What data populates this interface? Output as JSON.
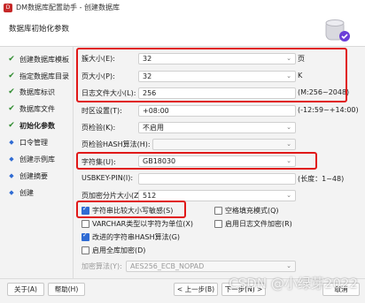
{
  "window": {
    "title": "DM数据库配置助手 - 创建数据库"
  },
  "header": {
    "title": "数据库初始化参数"
  },
  "sidebar": {
    "items": [
      {
        "label": "创建数据库模板",
        "state": "done"
      },
      {
        "label": "指定数据库目录",
        "state": "done"
      },
      {
        "label": "数据库标识",
        "state": "done"
      },
      {
        "label": "数据库文件",
        "state": "done"
      },
      {
        "label": "初始化参数",
        "state": "active"
      },
      {
        "label": "口令管理",
        "state": "pending"
      },
      {
        "label": "创建示例库",
        "state": "pending"
      },
      {
        "label": "创建摘要",
        "state": "pending"
      },
      {
        "label": "创建",
        "state": "pending"
      }
    ]
  },
  "form": {
    "extent_size": {
      "label": "簇大小(E):",
      "value": "32",
      "unit": "页"
    },
    "page_size": {
      "label": "页大小(P):",
      "value": "32",
      "unit": "K"
    },
    "log_size": {
      "label": "日志文件大小(L):",
      "value": "256",
      "unit": "(M:256~2048)"
    },
    "time_zone": {
      "label": "时区设置(T):",
      "value": "+08:00",
      "unit": "(-12:59~+14:00)"
    },
    "page_check": {
      "label": "页检验(K):",
      "value": "不启用"
    },
    "page_check_hash": {
      "label": "页检验HASH算法(H):",
      "value": ""
    },
    "charset": {
      "label": "字符集(U):",
      "value": "GB18030"
    },
    "usbkey_pin": {
      "label": "USBKEY-PIN(I):",
      "value": "",
      "unit": "(长度：1~48)"
    },
    "page_partition": {
      "label": "页加密分片大小(Z):",
      "value": "512"
    },
    "case_sensitive": {
      "label": "字符串比较大小写敏感(S)",
      "checked": true
    },
    "space_fill": {
      "label": "空格填充模式(Q)",
      "checked": false
    },
    "varchar_char": {
      "label": "VARCHAR类型以字符为单位(X)",
      "checked": false
    },
    "log_encrypt": {
      "label": "启用日志文件加密(R)",
      "checked": false
    },
    "improved_hash": {
      "label": "改进的字符串HASH算法(G)",
      "checked": true
    },
    "full_db_encrypt": {
      "label": "启用全库加密(D)",
      "checked": false
    },
    "encrypt_algo": {
      "label": "加密算法(Y):",
      "value": "AES256_ECB_NOPAD"
    }
  },
  "footer": {
    "about": "关于(A)",
    "help": "帮助(H)",
    "prev": "< 上一步(B)",
    "next": "下一步(N) >",
    "cancel": "取消"
  },
  "watermark": "CSDN @小绿芽2022",
  "colors": {
    "highlight_red": "#e01818",
    "check_green": "#2e8b2e",
    "accent_blue": "#2f6bd3"
  }
}
